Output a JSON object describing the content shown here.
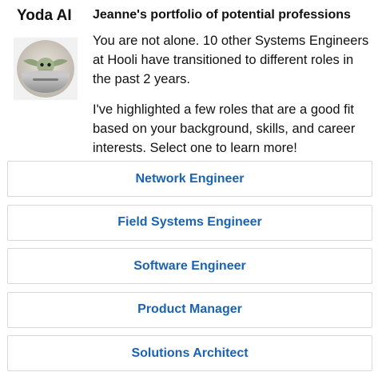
{
  "bot": {
    "name": "Yoda AI",
    "avatar_icon": "baby-yoda-avatar"
  },
  "message": {
    "title": "Jeanne's portfolio of potential professions",
    "paragraph_1": "You are not alone. 10 other Systems Engineers at Hooli have transitioned to different roles in the past 2 years.",
    "paragraph_2": "I've highlighted a few roles that are a good fit based on your background, skills, and career interests. Select one to learn more!"
  },
  "options": [
    {
      "label": "Network Engineer"
    },
    {
      "label": "Field Systems Engineer"
    },
    {
      "label": "Software Engineer"
    },
    {
      "label": "Product Manager"
    },
    {
      "label": "Solutions Architect"
    }
  ],
  "colors": {
    "option_text": "#1a63b0",
    "option_border": "#d8d8d8",
    "avatar_frame": "#f1f1f1"
  }
}
